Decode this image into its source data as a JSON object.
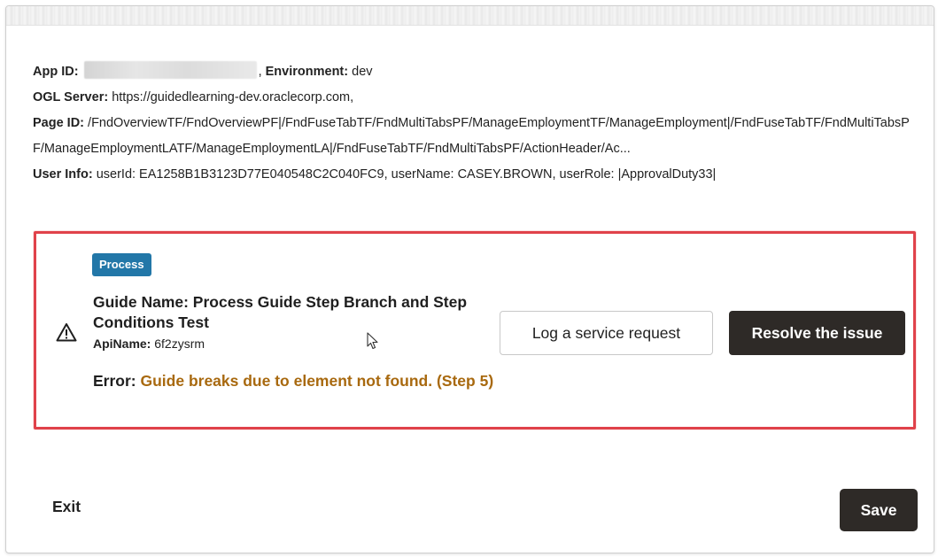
{
  "info": {
    "app_id_label": "App ID:",
    "environment_label": "Environment:",
    "environment_value": "dev",
    "ogl_server_label": "OGL Server:",
    "ogl_server_value": "https://guidedlearning-dev.oraclecorp.com,",
    "page_id_label": "Page ID:",
    "page_id_value": "/FndOverviewTF/FndOverviewPF|/FndFuseTabTF/FndMultiTabsPF/ManageEmploymentTF/ManageEmployment|/FndFuseTabTF/FndMultiTabsPF/ManageEmploymentLATF/ManageEmploymentLA|/FndFuseTabTF/FndMultiTabsPF/ActionHeader/Ac...",
    "user_info_label": "User Info:",
    "user_info_value": "userId: EA1258B1B3123D77E040548C2C040FC9, userName: CASEY.BROWN, userRole: |ApprovalDuty33|"
  },
  "issue": {
    "badge": "Process",
    "guide_name": "Guide Name: Process Guide Step Branch and Step Conditions Test",
    "api_name_label": "ApiName:",
    "api_name_value": "6f2zysrm",
    "error_label": "Error:",
    "error_message": "Guide breaks due to element not found. (Step 5)",
    "log_request_label": "Log a service request",
    "resolve_label": "Resolve the issue",
    "highlight_color": "#e0424a",
    "badge_color": "#2277a8",
    "error_color": "#a8690f"
  },
  "footer": {
    "exit_label": "Exit",
    "save_label": "Save"
  },
  "icons": {
    "warning": "warning-triangle-icon",
    "cursor": "mouse-pointer-icon"
  }
}
